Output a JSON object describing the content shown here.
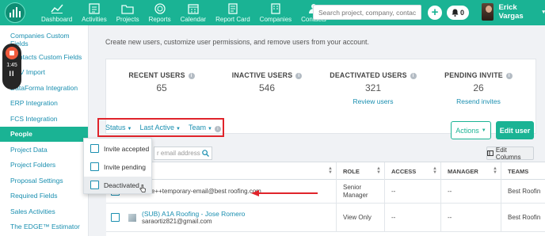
{
  "topbar": {
    "nav": [
      {
        "label": "Dashboard",
        "icon": "dashboard-icon"
      },
      {
        "label": "Activities",
        "icon": "activities-icon"
      },
      {
        "label": "Projects",
        "icon": "projects-icon"
      },
      {
        "label": "Reports",
        "icon": "reports-icon"
      },
      {
        "label": "Calendar",
        "icon": "calendar-icon"
      },
      {
        "label": "Report Card",
        "icon": "report-card-icon"
      },
      {
        "label": "Companies",
        "icon": "companies-icon"
      },
      {
        "label": "Contacts",
        "icon": "contacts-icon"
      }
    ],
    "search_placeholder": "Search project, company, contac",
    "notifications_count": "0",
    "user_name": "Erick Vargas",
    "accent_color": "#1ab394"
  },
  "recorder": {
    "time": "1:45",
    "pause": "II"
  },
  "sidebar": {
    "items": [
      {
        "label": "Companies Custom Fields",
        "active": false
      },
      {
        "label": "Contacts Custom Fields",
        "active": false
      },
      {
        "label": "CSV Import",
        "active": false
      },
      {
        "label": "DataForma Integration",
        "active": false
      },
      {
        "label": "ERP Integration",
        "active": false
      },
      {
        "label": "FCS Integration",
        "active": false
      },
      {
        "label": "People",
        "active": true
      },
      {
        "label": "Project Data",
        "active": false
      },
      {
        "label": "Project Folders",
        "active": false
      },
      {
        "label": "Proposal Settings",
        "active": false
      },
      {
        "label": "Required Fields",
        "active": false
      },
      {
        "label": "Sales Activities",
        "active": false
      },
      {
        "label": "The EDGE™ Estimator",
        "active": false
      }
    ]
  },
  "main": {
    "description": "Create new users, customize user permissions, and remove users from your account.",
    "stats": [
      {
        "label": "RECENT USERS",
        "value": "65",
        "link": ""
      },
      {
        "label": "INACTIVE USERS",
        "value": "546",
        "link": ""
      },
      {
        "label": "DEACTIVATED USERS",
        "value": "321",
        "link": "Review users"
      },
      {
        "label": "PENDING INVITE",
        "value": "26",
        "link": "Resend invites"
      }
    ],
    "filters": {
      "status": "Status",
      "last_active": "Last Active",
      "team": "Team"
    },
    "actions_label": "Actions",
    "edit_user_label": "Edit user",
    "table_search_placeholder": "r email address",
    "edit_columns_label": "Edit Columns",
    "columns": [
      "ROLE",
      "ACCESS",
      "MANAGER",
      "TEAMS"
    ],
    "rows": [
      {
        "name": "",
        "email": "ctive++temporary-email@best roofing.com",
        "role": "Senior Manager",
        "access": "--",
        "manager": "--",
        "teams": "Best Roofin"
      },
      {
        "name": "(SUB) A1A Roofing - Jose Romero",
        "email": "saraortiz821@gmail.com",
        "role": "View Only",
        "access": "--",
        "manager": "--",
        "teams": "Best Roofin"
      }
    ],
    "status_dropdown": [
      {
        "label": "Invite accepted",
        "hover": false
      },
      {
        "label": "Invite pending",
        "hover": false
      },
      {
        "label": "Deactivated",
        "hover": true
      }
    ]
  }
}
